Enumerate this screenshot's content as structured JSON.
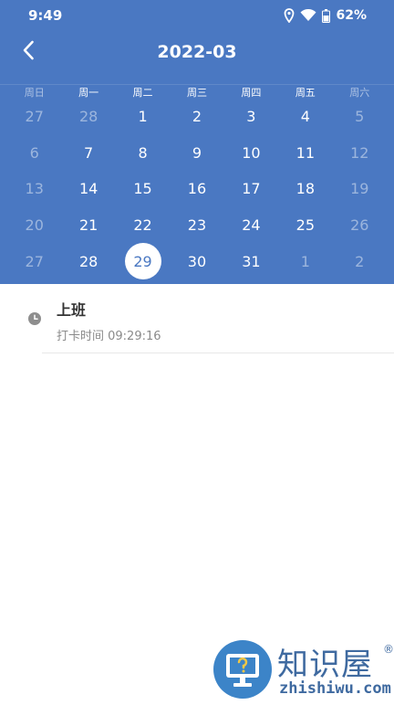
{
  "status_bar": {
    "time": "9:49",
    "battery": "62%",
    "icons": [
      "location-icon",
      "wifi-icon",
      "battery-icon"
    ]
  },
  "header": {
    "title": "2022-03",
    "back_icon": "chevron-left-icon",
    "background_color": "#4a78c2"
  },
  "calendar": {
    "weekdays": [
      "周日",
      "周一",
      "周二",
      "周三",
      "周四",
      "周五",
      "周六"
    ],
    "weeks": [
      [
        "27",
        "28",
        "1",
        "2",
        "3",
        "4",
        "5"
      ],
      [
        "6",
        "7",
        "8",
        "9",
        "10",
        "11",
        "12"
      ],
      [
        "13",
        "14",
        "15",
        "16",
        "17",
        "18",
        "19"
      ],
      [
        "20",
        "21",
        "22",
        "23",
        "24",
        "25",
        "26"
      ],
      [
        "27",
        "28",
        "29",
        "30",
        "31",
        "1",
        "2"
      ]
    ],
    "selected_day": "29"
  },
  "record": {
    "title": "上班",
    "time": "打卡时间 09:29:16",
    "icon": "clock-icon"
  },
  "watermark": {
    "name_cn": "知识屋",
    "reg": "®",
    "site": "zhishiwu.com"
  }
}
